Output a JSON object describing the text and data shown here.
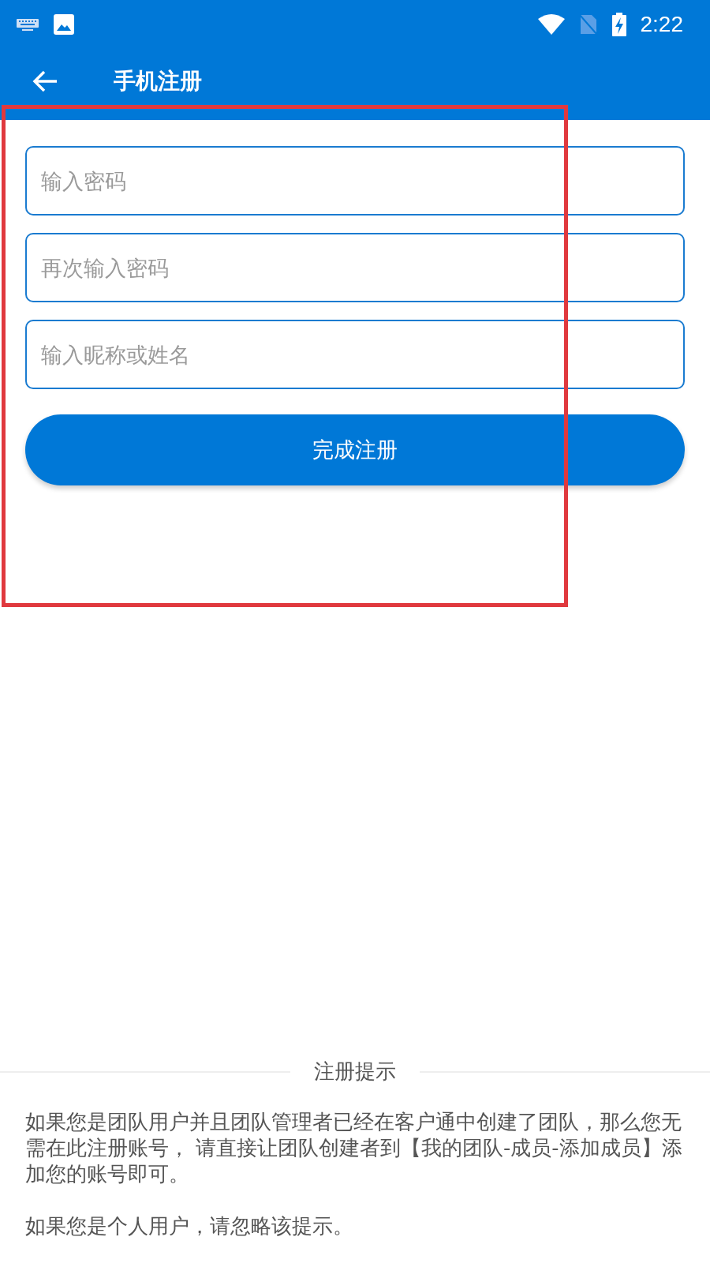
{
  "status_bar": {
    "time": "2:22"
  },
  "app_bar": {
    "title": "手机注册"
  },
  "fields": [
    {
      "placeholder": "输入密码"
    },
    {
      "placeholder": "再次输入密码"
    },
    {
      "placeholder": "输入昵称或姓名"
    }
  ],
  "submit_button": {
    "label": "完成注册"
  },
  "notice": {
    "title": "注册提示",
    "paragraphs": [
      "如果您是团队用户并且团队管理者已经在客户通中创建了团队，那么您无需在此注册账号， 请直接让团队创建者到【我的团队-成员-添加成员】添加您的账号即可。",
      "如果您是个人用户，请忽略该提示。"
    ]
  }
}
